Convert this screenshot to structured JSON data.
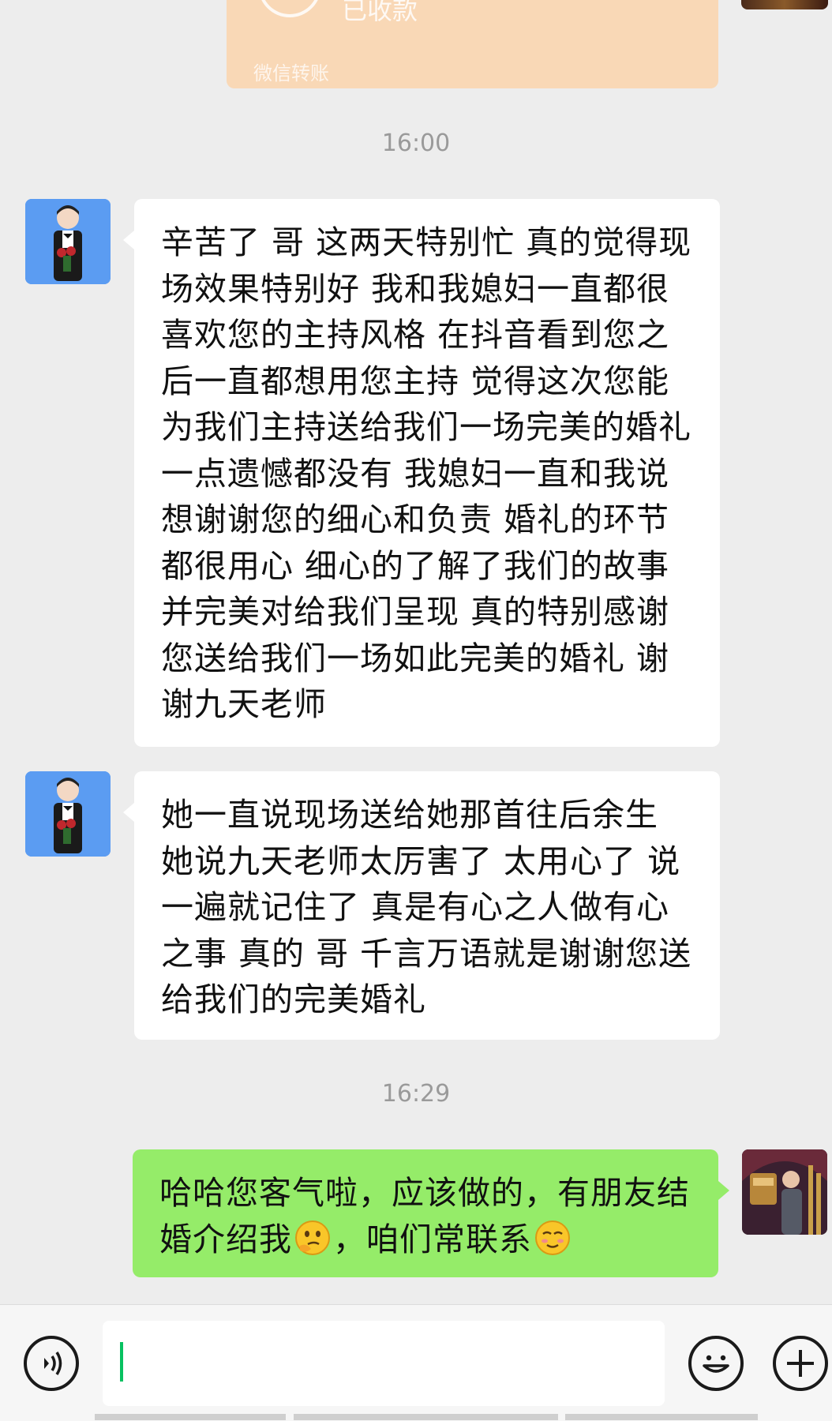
{
  "transfer": {
    "status": "已收款",
    "label": "微信转账"
  },
  "timestamps": [
    "16:00",
    "16:29"
  ],
  "messages": {
    "m1": "辛苦了 哥 这两天特别忙 真的觉得现场效果特别好 我和我媳妇一直都很喜欢您的主持风格 在抖音看到您之后一直都想用您主持 觉得这次您能为我们主持送给我们一场完美的婚礼一点遗憾都没有 我媳妇一直和我说想谢谢您的细心和负责 婚礼的环节都很用心 细心的了解了我们的故事 并完美对给我们呈现 真的特别感谢您送给我们一场如此完美的婚礼 谢谢九天老师",
    "m2": "她一直说现场送给她那首往后余生 她说九天老师太厉害了 太用心了 说一遍就记住了 真是有心之人做有心之事 真的 哥 千言万语就是谢谢您送给我们的完美婚礼",
    "m3_part1": "哈哈您客气啦，应该做的，有朋友结婚介绍我",
    "m3_part2": "，咱们常联系"
  },
  "colors": {
    "background": "#ededed",
    "bubble_incoming": "#ffffff",
    "bubble_outgoing": "#95ec69",
    "transfer_card": "#f9d8b6",
    "caret": "#07c160"
  },
  "icons": {
    "voice": "voice-icon",
    "emoji": "emoji-icon",
    "add": "add-icon",
    "emoji_thinking": "thinking-face-icon",
    "emoji_blush": "smiling-face-icon"
  }
}
